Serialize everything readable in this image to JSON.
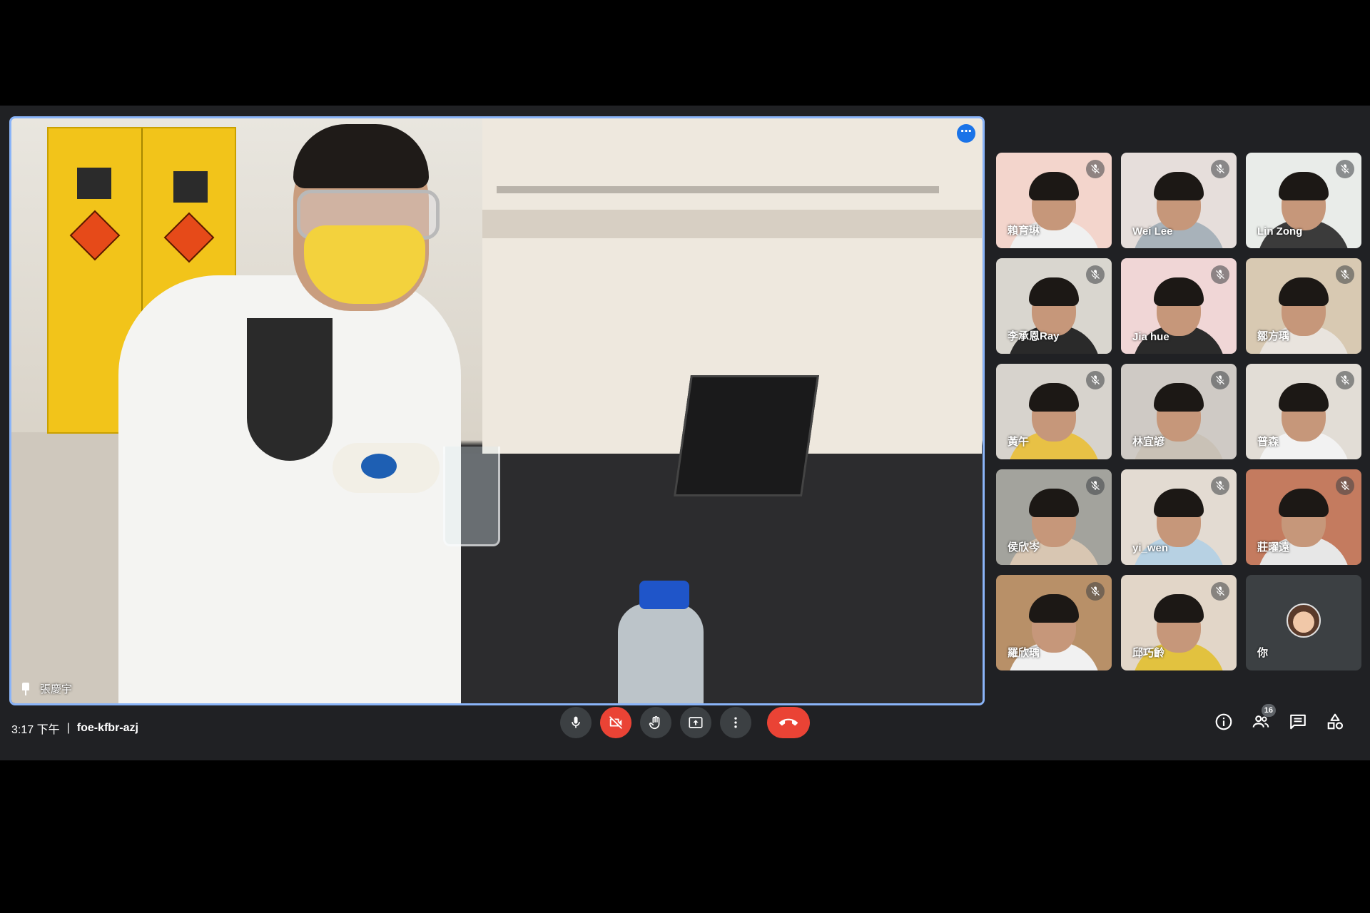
{
  "presenter": {
    "name": "張慶宇"
  },
  "participants": [
    {
      "name": "賴育琳",
      "bg": "#f3d5cc",
      "body": "#f0f0f0"
    },
    {
      "name": "Wei Lee",
      "bg": "#e6dedb",
      "body": "#a8b2ba"
    },
    {
      "name": "Lin Zong",
      "bg": "#e9ece9",
      "body": "#3b3b3b"
    },
    {
      "name": "李承恩Ray",
      "bg": "#d9d6cf",
      "body": "#2a2a2a"
    },
    {
      "name": "Jia hue",
      "bg": "#f0d6d6",
      "body": "#2b2b2b"
    },
    {
      "name": "鄒方瑀",
      "bg": "#d8c9b2",
      "body": "#e9e4de"
    },
    {
      "name": "黃午",
      "bg": "#d7d3cd",
      "body": "#e8c145"
    },
    {
      "name": "林宜諺",
      "bg": "#cfcac5",
      "body": "#c9c1b6"
    },
    {
      "name": "普森",
      "bg": "#e2ddd6",
      "body": "#f2f2f2"
    },
    {
      "name": "侯欣岑",
      "bg": "#a3a39d",
      "body": "#d8c6b2"
    },
    {
      "name": "yi_wen",
      "bg": "#e3dbd2",
      "body": "#b7d1e3"
    },
    {
      "name": "莊曜遠",
      "bg": "#c47b5f",
      "body": "#e7e7e7"
    },
    {
      "name": "羅欣瑀",
      "bg": "#b89068",
      "body": "#f1f1f1"
    },
    {
      "name": "邱巧齡",
      "bg": "#e2d6c8",
      "body": "#e2c23f"
    }
  ],
  "self": {
    "name": "你"
  },
  "bottom_bar": {
    "time": "3:17 下午",
    "separator": "|",
    "meeting_code": "foe-kfbr-azj",
    "participant_count": "16"
  },
  "colors": {
    "accent": "#8ab4f8",
    "end_call": "#ea4335",
    "background": "#202124"
  }
}
